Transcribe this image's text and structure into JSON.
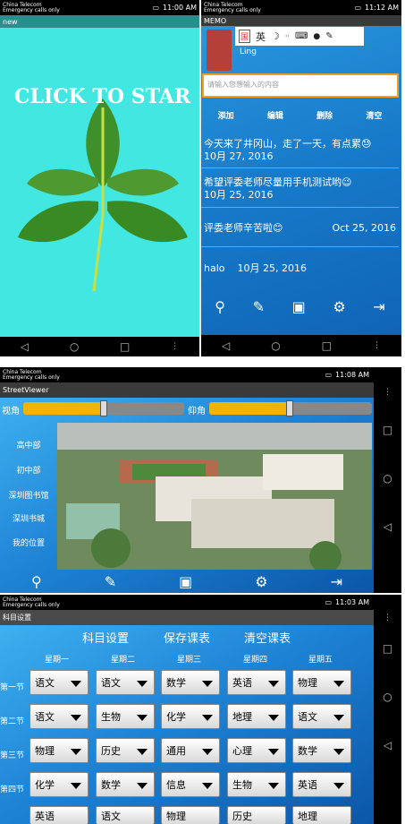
{
  "panel1": {
    "status": {
      "carrier": "China Telecom",
      "emergency": "Emergency calls only",
      "battery": "100",
      "time": "11:00 AM"
    },
    "title": "new",
    "splash_text": "CLICK TO STAR"
  },
  "panel2": {
    "status": {
      "carrier": "China Telecom",
      "emergency": "Emergency calls only",
      "battery": "100",
      "time": "11:12 AM"
    },
    "title": "MEMO",
    "user_name": "Ling",
    "ime": {
      "zh_icon": "国",
      "en": "英"
    },
    "input_placeholder": "请输入您想输入的内容",
    "actions": {
      "add": "添加",
      "edit": "编辑",
      "delete": "删除",
      "clear": "清空"
    },
    "memos": [
      {
        "text": "今天来了井冈山，走了一天，有点累😓",
        "date": "10月 27, 2016"
      },
      {
        "text": "希望评委老师尽量用手机测试哟😉",
        "date": "10月 25, 2016"
      },
      {
        "text": "评委老师辛苦啦😊",
        "date": "Oct 25, 2016"
      },
      {
        "text": "halo",
        "date": "10月 25, 2016"
      }
    ]
  },
  "panel3": {
    "status": {
      "carrier": "China Telecom",
      "emergency": "Emergency calls only",
      "battery": "100",
      "time": "11:08 AM"
    },
    "title": "StreetViewer",
    "pitch_label": "视角",
    "elevation_label": "仰角",
    "pitch_value": 0.5,
    "elevation_value": 0.5,
    "places": [
      "高中部",
      "初中部",
      "深圳图书馆",
      "深圳书城",
      "我的位置"
    ]
  },
  "panel4": {
    "status": {
      "carrier": "China Telecom",
      "emergency": "Emergency calls only",
      "battery": "100",
      "time": "11:03 AM"
    },
    "title": "科目设置",
    "header_actions": {
      "subject": "科目设置",
      "save": "保存课表",
      "clear": "清空课表"
    },
    "days": [
      "星期一",
      "星期二",
      "星期三",
      "星期四",
      "星期五"
    ],
    "periods": [
      "第一节",
      "第二节",
      "第三节",
      "第四节"
    ],
    "grid": [
      [
        "语文",
        "语文",
        "数学",
        "英语",
        "物理"
      ],
      [
        "语文",
        "生物",
        "化学",
        "地理",
        "语文"
      ],
      [
        "物理",
        "历史",
        "通用",
        "心理",
        "数学"
      ],
      [
        "化学",
        "数学",
        "信息",
        "生物",
        "英语"
      ],
      [
        "英语",
        "语文",
        "物理",
        "历史",
        "地理"
      ]
    ]
  },
  "colors": {
    "cyan": "#43E7E2",
    "blue": "#1F84D6",
    "gold": "#F2B400"
  }
}
